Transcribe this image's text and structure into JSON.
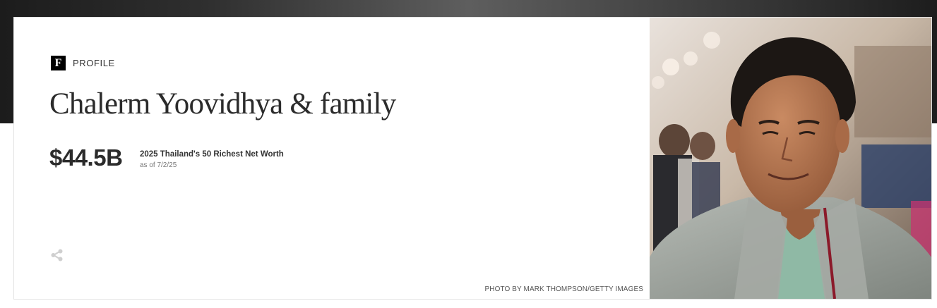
{
  "header": {
    "brand_icon": "forbes-f-logo",
    "brand_letter": "F",
    "section_label": "PROFILE"
  },
  "profile": {
    "name": "Chalerm Yoovidhya & family",
    "net_worth": "$44.5B",
    "list_name": "2025 Thailand's 50 Richest Net Worth",
    "as_of": "as of 7/2/25"
  },
  "actions": {
    "share_icon": "share-icon"
  },
  "photo": {
    "credit": "PHOTO BY MARK THOMPSON/GETTY IMAGES"
  },
  "colors": {
    "top_band": "#3a3a3a",
    "text_primary": "#2b2b2b",
    "text_muted": "#777777",
    "share_icon": "#cfcfcf"
  }
}
